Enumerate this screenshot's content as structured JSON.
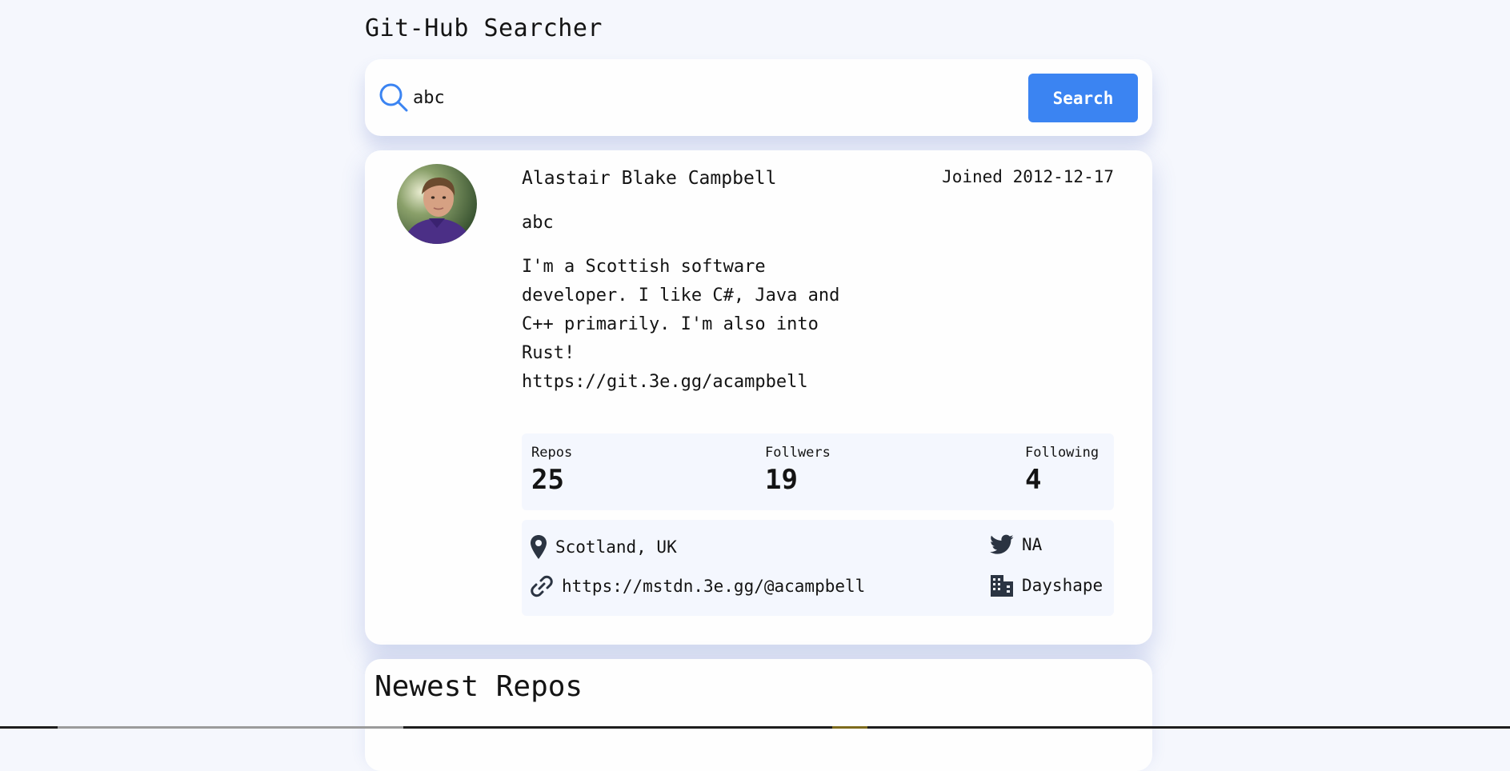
{
  "app": {
    "title": "Git-Hub Searcher"
  },
  "search": {
    "value": "abc",
    "button_label": "Search"
  },
  "profile": {
    "name": "Alastair Blake Campbell",
    "joined": "Joined 2012-12-17",
    "login": "abc",
    "bio": "I'm a Scottish software developer. I like C#, Java and C++ primarily. I'm also into Rust! https://git.3e.gg/acampbell",
    "stats": {
      "repos_label": "Repos",
      "repos_value": "25",
      "followers_label": "Follwers",
      "followers_value": "19",
      "following_label": "Following",
      "following_value": "4"
    },
    "info": {
      "location": "Scotland, UK",
      "blog": "https://mstdn.3e.gg/@acampbell",
      "twitter": "NA",
      "company": "Dayshape"
    }
  },
  "repos": {
    "title": "Newest Repos"
  },
  "colors": {
    "accent": "#3b84f2",
    "background": "#f5f7fd",
    "card": "#fefefe",
    "panel": "#f4f7fe"
  }
}
